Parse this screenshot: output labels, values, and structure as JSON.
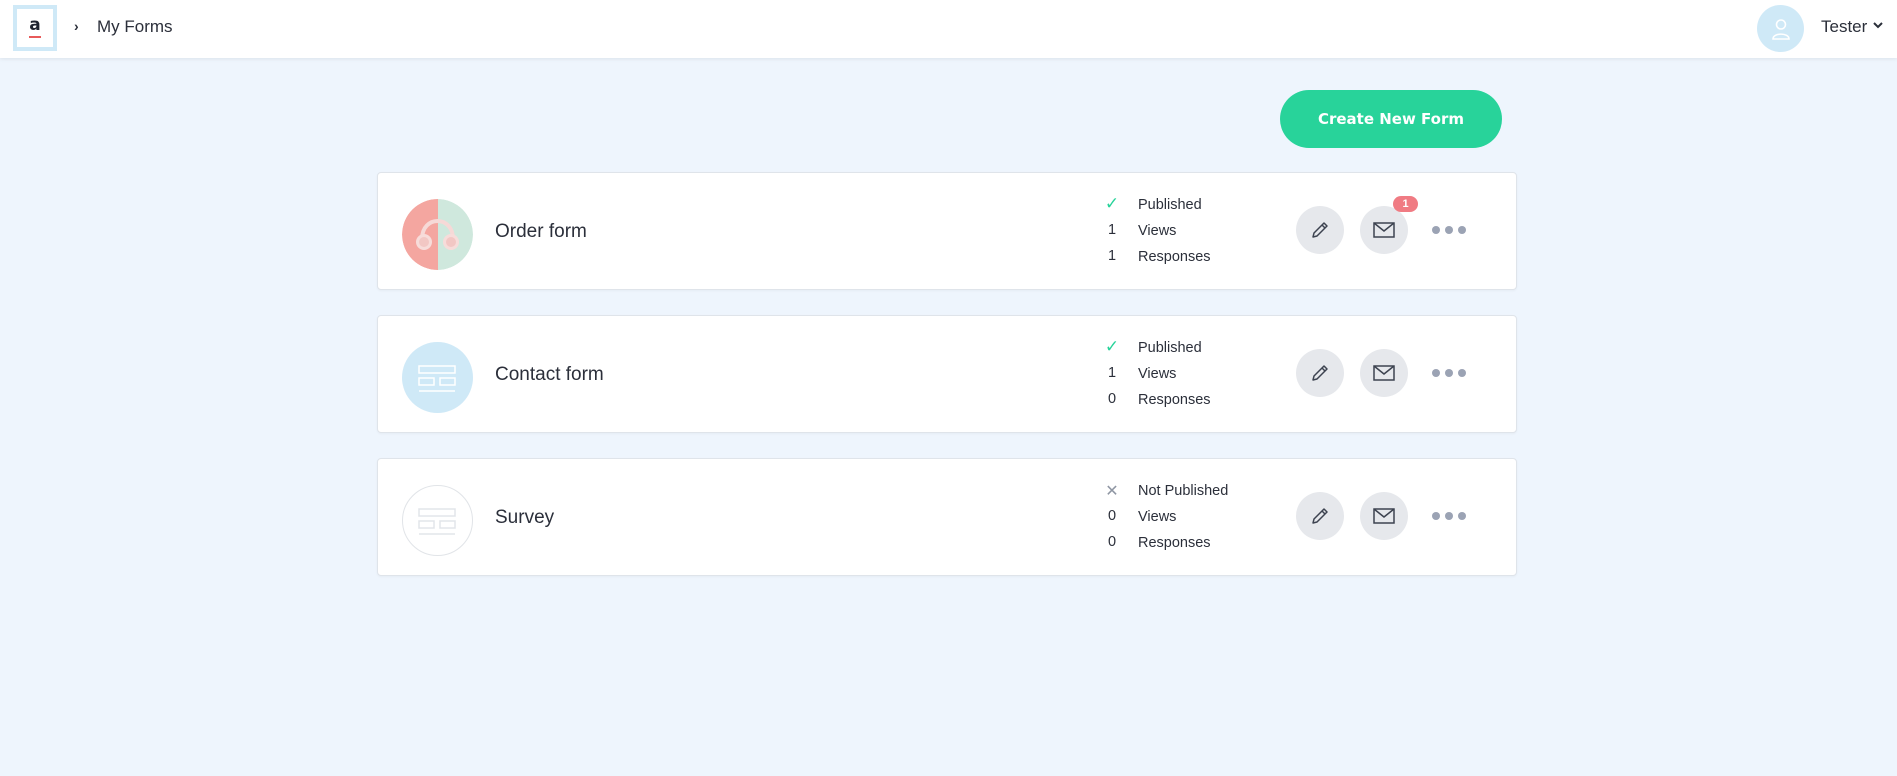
{
  "header": {
    "logo_letter": "a",
    "breadcrumb_separator": "›",
    "breadcrumb_title": "My Forms",
    "user_name": "Tester"
  },
  "actions": {
    "create_label": "Create New Form"
  },
  "colors": {
    "accent": "#28d39a",
    "check": "#28d39a",
    "badge": "#f07b83",
    "background": "#eef5fd"
  },
  "forms": [
    {
      "title": "Order form",
      "status": "Published",
      "published": true,
      "views": "1",
      "views_label": "Views",
      "responses": "1",
      "responses_label": "Responses",
      "badge": "1",
      "thumbnail_icon": "headphones-illustration"
    },
    {
      "title": "Contact form",
      "status": "Published",
      "published": true,
      "views": "1",
      "views_label": "Views",
      "responses": "0",
      "responses_label": "Responses",
      "thumbnail_icon": "form-layout-icon"
    },
    {
      "title": "Survey",
      "status": "Not Published",
      "published": false,
      "views": "0",
      "views_label": "Views",
      "responses": "0",
      "responses_label": "Responses",
      "thumbnail_icon": "form-layout-outline-icon"
    }
  ],
  "icons": {
    "check": "✓",
    "cross": "✕",
    "edit": "pencil-icon",
    "mail": "envelope-icon",
    "more": "more-dots-icon",
    "avatar": "user-icon",
    "caret": "chevron-down-icon"
  }
}
